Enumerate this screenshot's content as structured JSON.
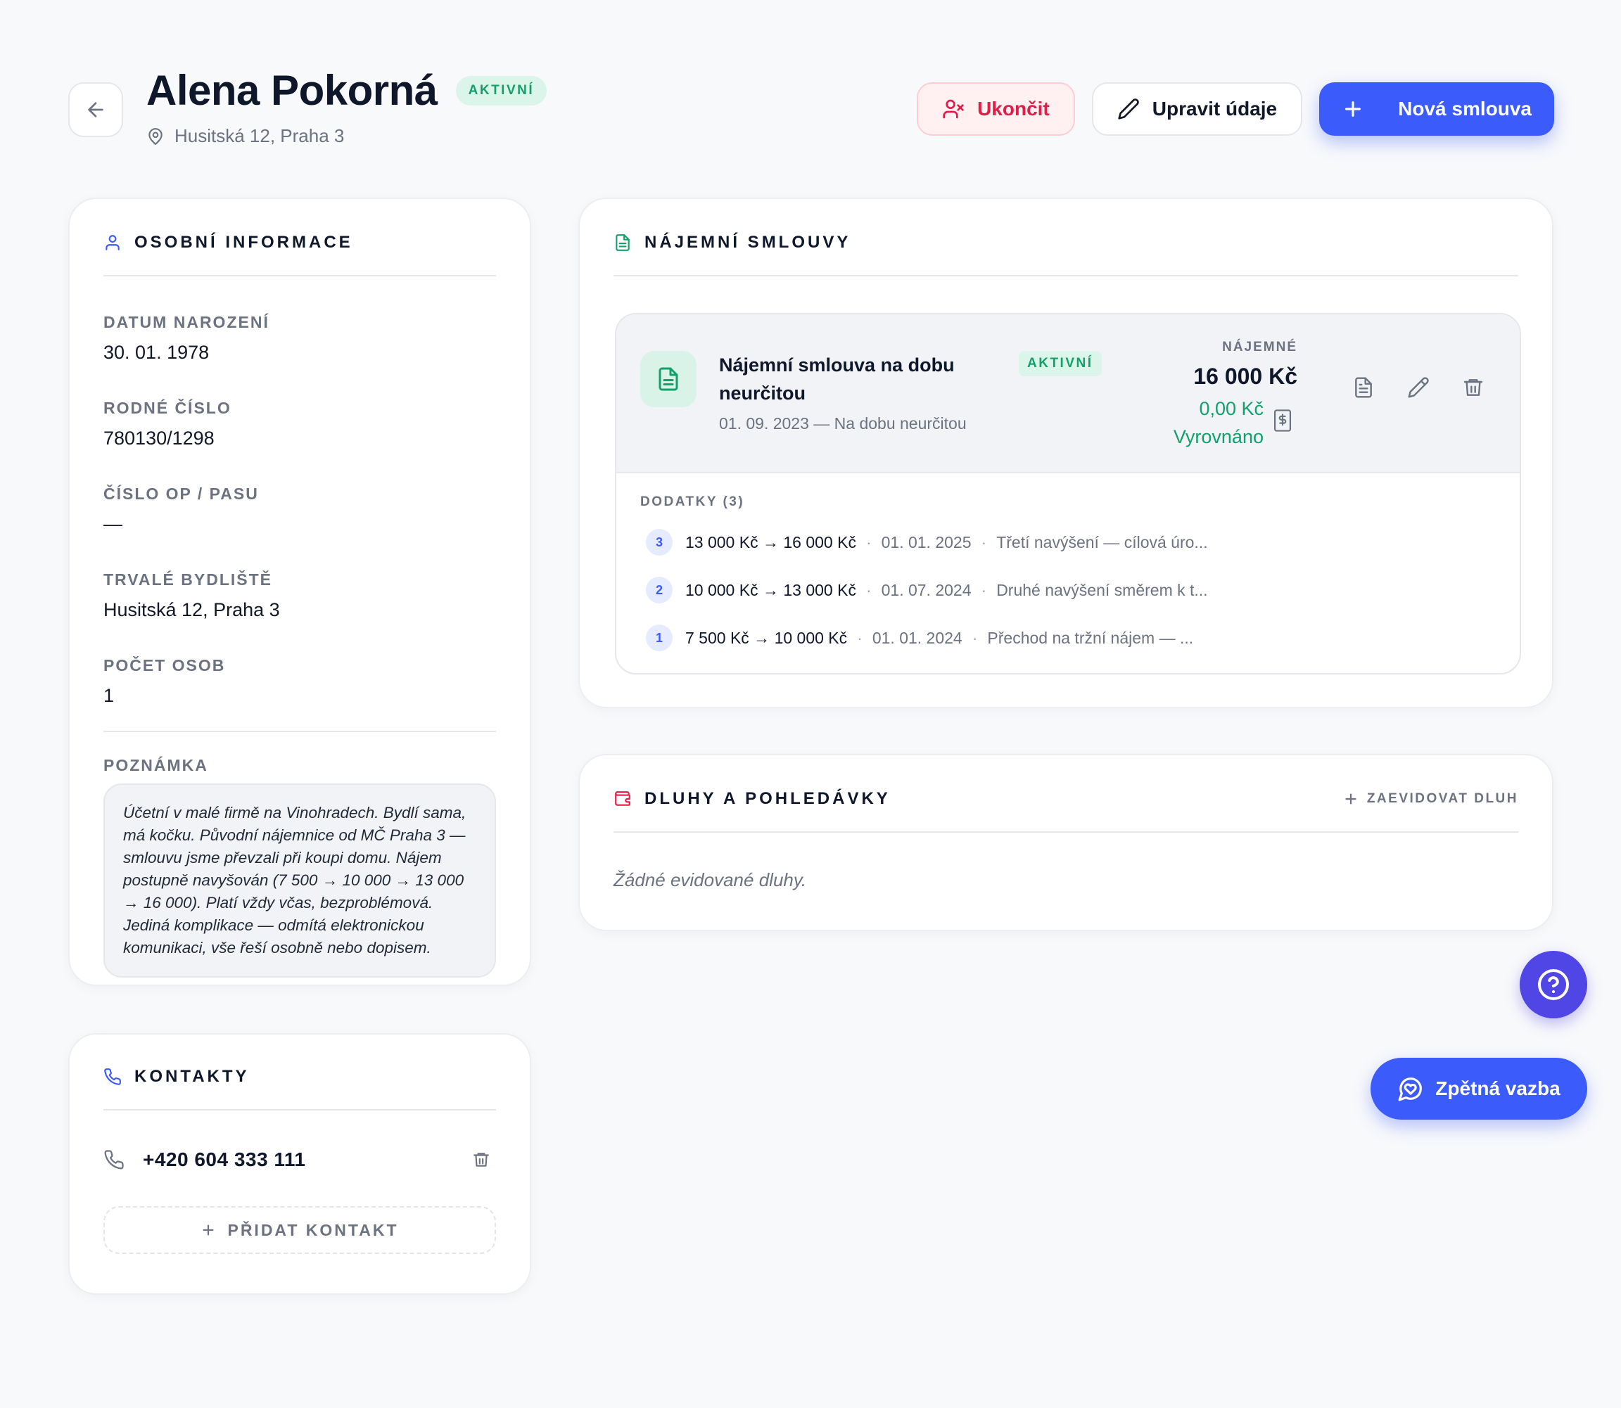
{
  "header": {
    "title": "Alena Pokorná",
    "status_badge": "AKTIVNÍ",
    "address": "Husitská 12, Praha 3",
    "actions": {
      "end": "Ukončit",
      "edit": "Upravit údaje",
      "new_contract": "Nová smlouva"
    }
  },
  "personal": {
    "heading": "OSOBNÍ INFORMACE",
    "fields": [
      {
        "label": "DATUM NAROZENÍ",
        "value": "30. 01. 1978"
      },
      {
        "label": "RODNÉ ČÍSLO",
        "value": "780130/1298"
      },
      {
        "label": "ČÍSLO OP / PASU",
        "value": "—"
      },
      {
        "label": "TRVALÉ BYDLIŠTĚ",
        "value": "Husitská 12, Praha 3"
      },
      {
        "label": "POČET OSOB",
        "value": "1"
      }
    ],
    "note_label": "POZNÁMKA",
    "note": "Účetní v malé firmě na Vinohradech. Bydlí sama, má kočku. Původní nájemnice od MČ Praha 3 — smlouvu jsme převzali při koupi domu. Nájem postupně navyšován (7 500 → 10 000 → 13 000 → 16 000). Platí vždy včas, bezproblémová. Jediná komplikace — odmítá elektronickou komunikaci, vše řeší osobně nebo dopisem."
  },
  "contacts": {
    "heading": "KONTAKTY",
    "items": [
      {
        "phone": "+420 604 333 111"
      }
    ],
    "add_label": "PŘIDAT KONTAKT"
  },
  "contracts": {
    "heading": "NÁJEMNÍ SMLOUVY",
    "contract": {
      "title": "Nájemní smlouva na dobu neurčitou",
      "badge": "AKTIVNÍ",
      "dates": "01. 09. 2023 — Na dobu neurčitou",
      "rent_label": "NÁJEMNÉ",
      "rent_value": "16 000 Kč",
      "balance": "0,00 Kč",
      "balance_status": "Vyrovnáno"
    },
    "addenda_heading": "DODATKY (3)",
    "addenda": [
      {
        "num": "3",
        "change": "13 000 Kč → 16 000 Kč",
        "date": "01. 01. 2025",
        "note": "Třetí navýšení — cílová úro..."
      },
      {
        "num": "2",
        "change": "10 000 Kč → 13 000 Kč",
        "date": "01. 07. 2024",
        "note": "Druhé navýšení směrem k t..."
      },
      {
        "num": "1",
        "change": "7 500 Kč → 10 000 Kč",
        "date": "01. 01. 2024",
        "note": "Přechod na tržní nájem — ..."
      }
    ]
  },
  "debts": {
    "heading": "DLUHY A POHLEDÁVKY",
    "add_label": "ZAEVIDOVAT DLUH",
    "empty": "Žádné evidované dluhy."
  },
  "floating": {
    "feedback": "Zpětná vazba"
  },
  "colors": {
    "primary": "#3b5bfa",
    "success": "#13a06b",
    "danger": "#e11d48",
    "help": "#4f46e5"
  }
}
